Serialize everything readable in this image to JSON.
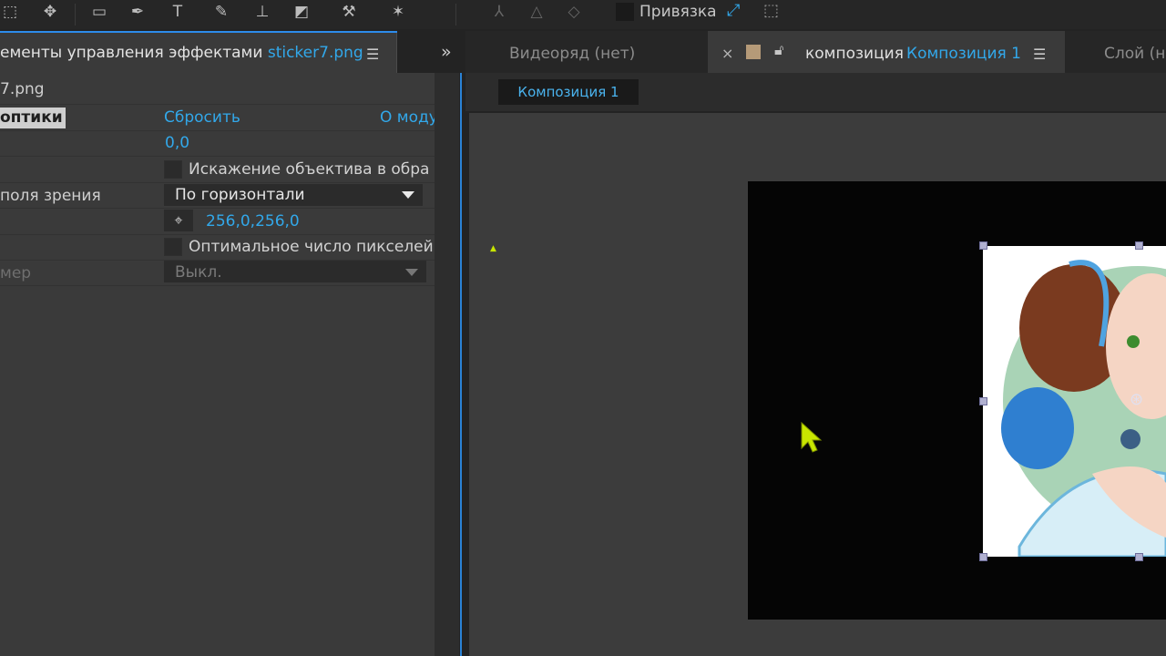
{
  "toolbar": {
    "tools": [
      "select-icon",
      "hand-icon",
      "rectangle-icon",
      "pen-icon",
      "type-icon",
      "brush-icon",
      "clone-stamp-icon",
      "eraser-icon",
      "roto-brush-icon",
      "puppet-pin-icon",
      "axis-local-icon",
      "axis-world-icon",
      "axis-view-icon"
    ],
    "snap_label": "Привязка"
  },
  "effect_controls": {
    "tab_title": "ементы управления эффектами",
    "tab_file": "sticker7.png",
    "layer_name": "7.png",
    "effect_name": "оптики",
    "reset_label": "Сбросить",
    "about_label": "О моду",
    "value_1": "0,0",
    "checkbox_1_label": "Искажение объектива в обра",
    "fov_label": "поля зрения",
    "fov_dropdown": "По горизонтали",
    "center_value": "256,0,256,0",
    "checkbox_2_label": "Оптимальное число пикселей",
    "size_label": "мер",
    "size_dropdown": "Выкл."
  },
  "right_panel": {
    "tab_footage": "Видеоряд (нет)",
    "close_glyph": "×",
    "comp_prefix": "композиция",
    "comp_name": "Композиция 1",
    "tab_layer": "Слой (нет",
    "chip": "Композиция 1"
  },
  "colors": {
    "accent_blue": "#32a8ea",
    "panel_bg": "#3a3a3a",
    "cursor": "#c8e600"
  }
}
